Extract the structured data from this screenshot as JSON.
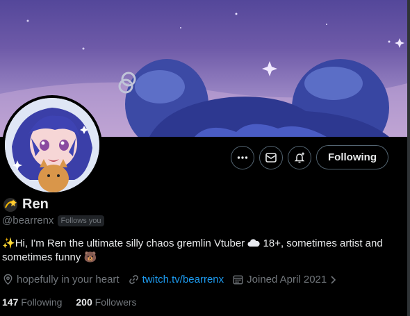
{
  "profile": {
    "name": "Ren",
    "handle": "@bearrenx",
    "follows_you": "Follows you",
    "bio_prefix": "✨",
    "bio_line1": "Hi, I'm Ren the ultimate silly chaos gremlin Vtuber",
    "bio_mid": "18+, sometimes artist and",
    "bio_line2": "sometimes funny",
    "bio_emoji_end": "🐻",
    "location": "hopefully in your heart",
    "website": "twitch.tv/bearrenx",
    "joined": "Joined April 2021",
    "following_count": "147",
    "following_label": "Following",
    "followers_count": "200",
    "followers_label": "Followers"
  },
  "actions": {
    "follow_label": "Following",
    "more_icon": "more-icon",
    "message_icon": "message-icon",
    "notify_icon": "notification-bell-icon"
  },
  "colors": {
    "background": "#000000",
    "text": "#e7e9ea",
    "muted": "#71767b",
    "link": "#1d9bf0",
    "border": "#536471"
  }
}
